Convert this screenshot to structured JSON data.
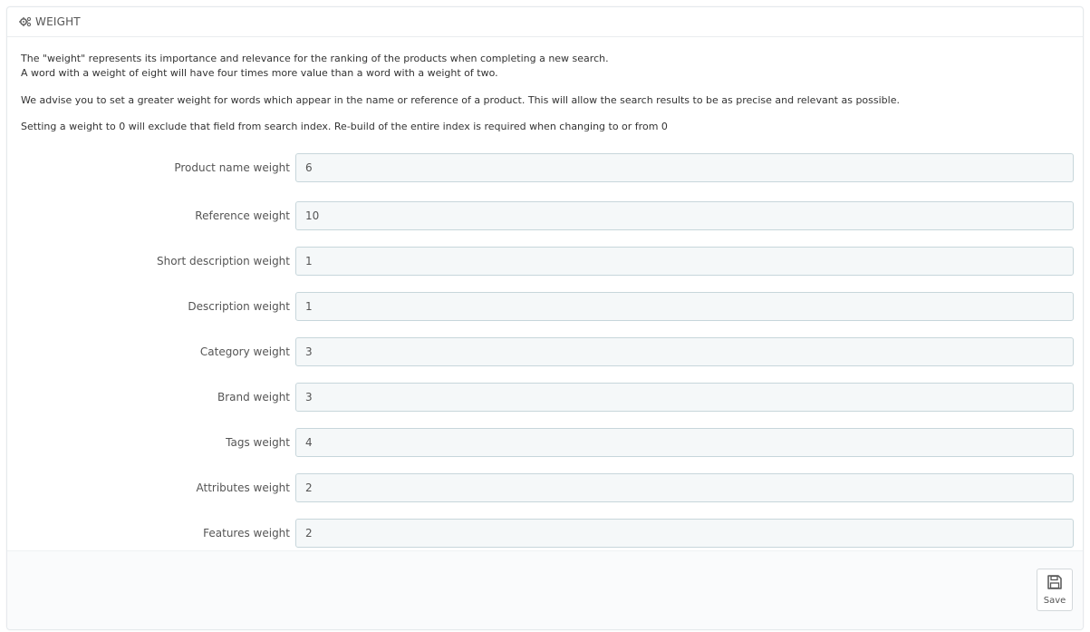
{
  "panel": {
    "title": "WEIGHT",
    "help": {
      "line1": "The \"weight\" represents its importance and relevance for the ranking of the products when completing a new search.",
      "line2": "A word with a weight of eight will have four times more value than a word with a weight of two.",
      "line3": "We advise you to set a greater weight for words which appear in the name or reference of a product. This will allow the search results to be as precise and relevant as possible.",
      "line4": "Setting a weight to 0 will exclude that field from search index. Re-build of the entire index is required when changing to or from 0"
    },
    "fields": [
      {
        "label": "Product name weight",
        "value": "6"
      },
      {
        "label": "Reference weight",
        "value": "10"
      },
      {
        "label": "Short description weight",
        "value": "1"
      },
      {
        "label": "Description weight",
        "value": "1"
      },
      {
        "label": "Category weight",
        "value": "3"
      },
      {
        "label": "Brand weight",
        "value": "3"
      },
      {
        "label": "Tags weight",
        "value": "4"
      },
      {
        "label": "Attributes weight",
        "value": "2"
      },
      {
        "label": "Features weight",
        "value": "2"
      }
    ],
    "save_label": "Save",
    "icons": {
      "heading": "cogs-icon",
      "save": "floppy-disk-icon"
    }
  }
}
